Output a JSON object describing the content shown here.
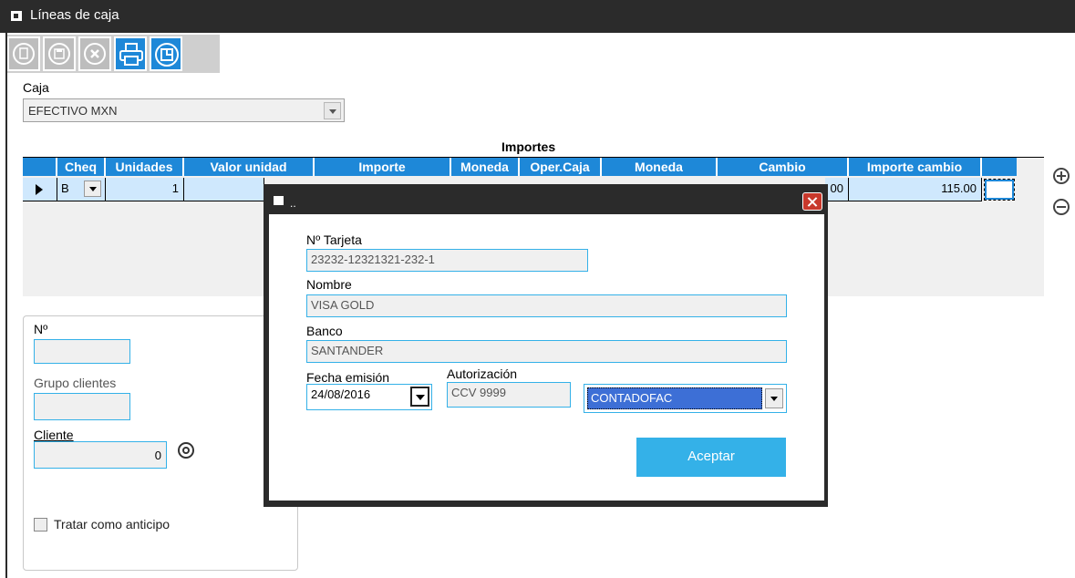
{
  "window": {
    "title": "Líneas de caja"
  },
  "toolbar": {
    "buttons": [
      "new-icon",
      "save-icon",
      "cancel-icon",
      "print-icon",
      "export-icon"
    ]
  },
  "caja": {
    "label": "Caja",
    "value": "EFECTIVO MXN"
  },
  "grid": {
    "group_header": "Importes",
    "columns": [
      "Cheq",
      "Unidades",
      "Valor unidad",
      "Importe",
      "Moneda",
      "Oper.Caja",
      "Moneda",
      "Cambio",
      "Importe cambio"
    ],
    "row": {
      "cheq": "B",
      "unidades": "1",
      "cambio_partial": "00",
      "importe_cambio": "115.00"
    }
  },
  "panel": {
    "no_label": "Nº",
    "grupo_label": "Grupo clientes",
    "cliente_label": "Cliente",
    "cliente_value": "0",
    "anticipo_label": "Tratar como anticipo"
  },
  "dialog": {
    "title": "..",
    "tarjeta_label": "Nº Tarjeta",
    "tarjeta_value": "23232-12321321-232-1",
    "nombre_label": "Nombre",
    "nombre_value": "VISA GOLD",
    "banco_label": "Banco",
    "banco_value": "SANTANDER",
    "fecha_label": "Fecha emisión",
    "fecha_value": "24/08/2016",
    "autorizacion_label": "Autorización",
    "autorizacion_value": "CCV 9999",
    "cuenta_value": "CONTADOFAC",
    "accept_label": "Aceptar"
  },
  "colors": {
    "accent": "#1e88d8",
    "field_border": "#34b1e8",
    "titlebar": "#2b2b2b",
    "selection": "#3d6fd6"
  }
}
